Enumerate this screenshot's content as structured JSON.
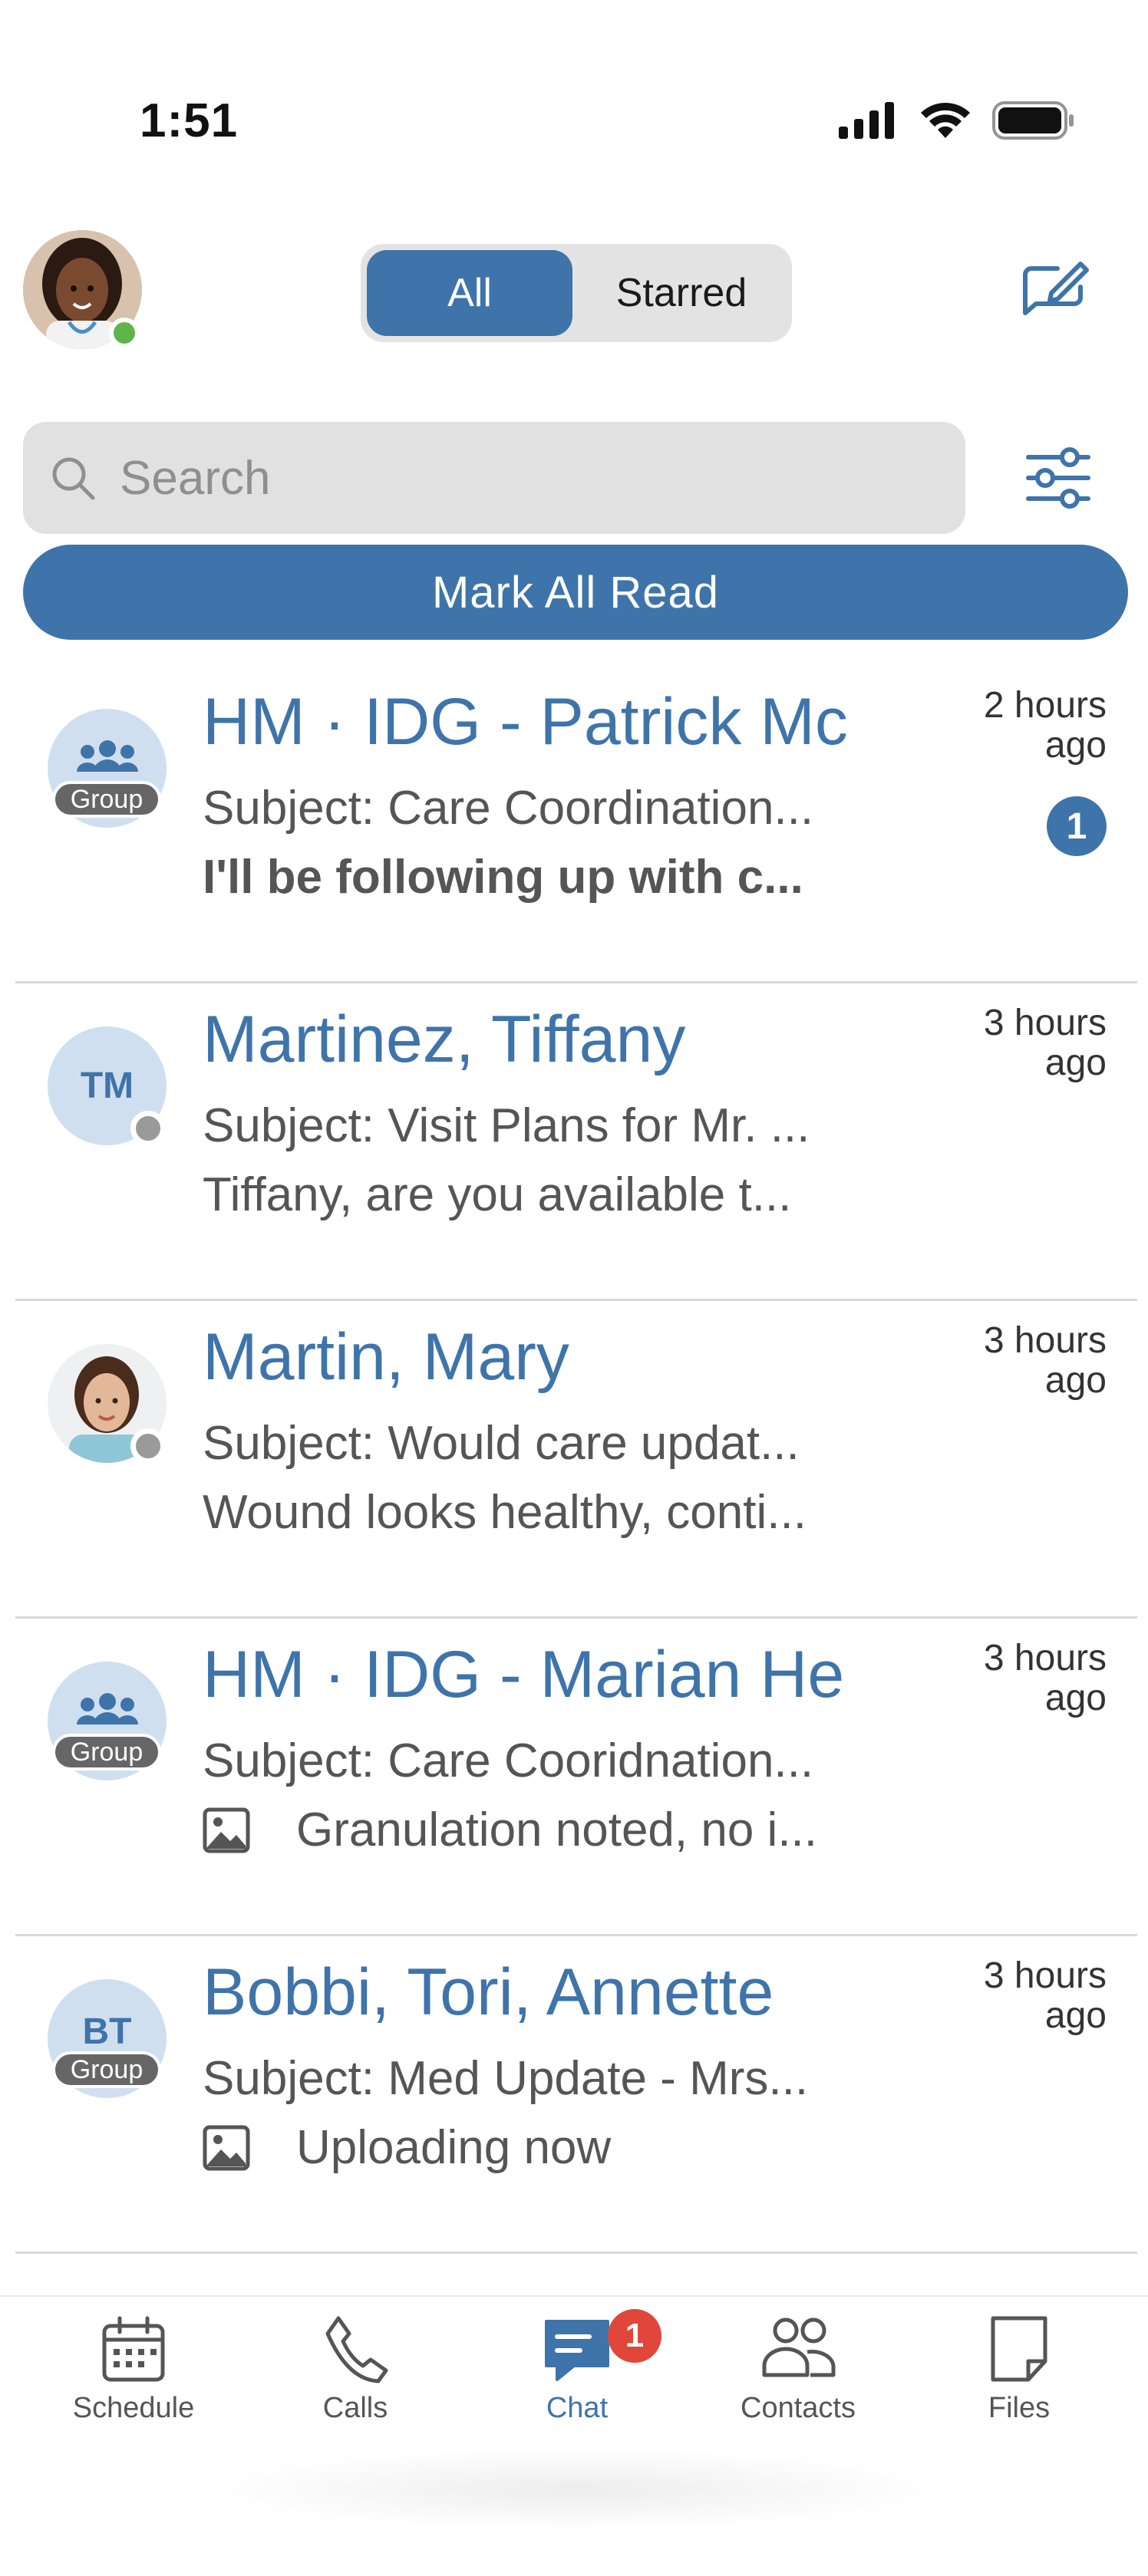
{
  "status_bar": {
    "time": "1:51"
  },
  "header": {
    "segments": [
      {
        "label": "All",
        "selected": true
      },
      {
        "label": "Starred",
        "selected": false
      }
    ]
  },
  "search": {
    "placeholder": "Search"
  },
  "mark_all_read": "Mark All Read",
  "conversations": [
    {
      "name": "HM · IDG - Patrick Mc",
      "subject": "Subject: Care Coordination...",
      "preview": "I'll be following up with c...",
      "time_line1": "2 hours",
      "time_line2": "ago",
      "badge": "1",
      "avatar_tag": "Group",
      "avatar_icon": "group-icon"
    },
    {
      "name": "Martinez, Tiffany",
      "subject": "Subject: Visit Plans for Mr. ...",
      "preview": "Tiffany, are you available t...",
      "time_line1": "3 hours",
      "time_line2": "ago",
      "avatar_initials": "TM"
    },
    {
      "name": "Martin, Mary",
      "subject": "Subject: Would care updat...",
      "preview": "Wound looks healthy, conti...",
      "time_line1": "3 hours",
      "time_line2": "ago"
    },
    {
      "name": "HM · IDG - Marian He",
      "subject": "Subject: Care Cooridnation...",
      "preview": "Granulation noted, no i...",
      "time_line1": "3 hours",
      "time_line2": "ago",
      "avatar_tag": "Group",
      "avatar_icon": "group-icon"
    },
    {
      "name": "Bobbi, Tori, Annette",
      "subject": "Subject: Med Update - Mrs...",
      "preview": "Uploading now",
      "time_line1": "3 hours",
      "time_line2": "ago",
      "avatar_initials": "BT",
      "avatar_tag": "Group"
    }
  ],
  "tabbar": {
    "tabs": [
      {
        "label": "Schedule",
        "icon": "calendar-icon"
      },
      {
        "label": "Calls",
        "icon": "phone-icon"
      },
      {
        "label": "Chat",
        "icon": "chat-icon",
        "active": true,
        "badge": "1"
      },
      {
        "label": "Contacts",
        "icon": "contacts-icon"
      },
      {
        "label": "Files",
        "icon": "file-icon"
      }
    ]
  },
  "colors": {
    "accent": "#3f74aa",
    "avatar_bg": "#cfdff0",
    "badge_red": "#e0463a",
    "online": "#5fb54a"
  }
}
